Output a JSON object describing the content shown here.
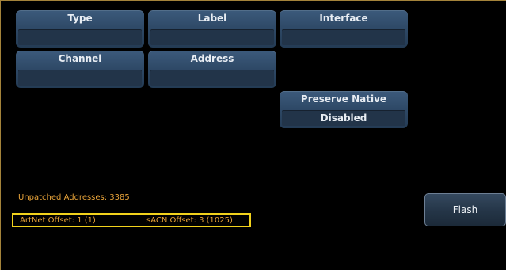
{
  "fields": {
    "type": {
      "label": "Type",
      "value": ""
    },
    "label": {
      "label": "Label",
      "value": ""
    },
    "interface": {
      "label": "Interface",
      "value": ""
    },
    "channel": {
      "label": "Channel",
      "value": ""
    },
    "address": {
      "label": "Address",
      "value": ""
    },
    "preserve_native": {
      "label": "Preserve Native",
      "value": "Disabled"
    }
  },
  "info": {
    "unpatched_addresses": "Unpatched Addresses: 3385",
    "artnet_offset": "ArtNet Offset: 1 (1)",
    "sacn_offset": "sACN Offset: 3 (1025)"
  },
  "buttons": {
    "flash": "Flash"
  },
  "colors": {
    "background": "#000000",
    "field_blue": "#2f4a68",
    "info_text": "#e9a43a",
    "highlight_box": "#f2d21c",
    "frame_border": "#a4833a"
  }
}
